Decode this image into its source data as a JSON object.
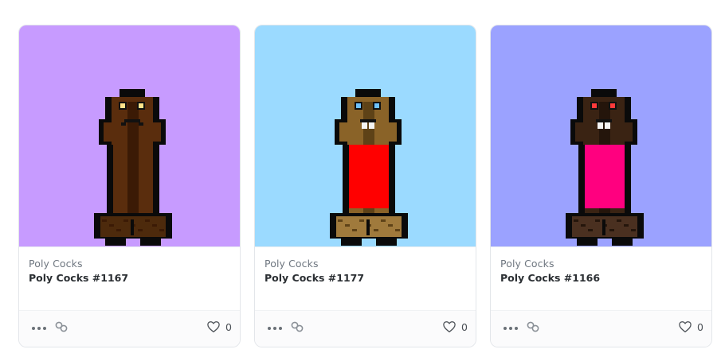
{
  "cards": [
    {
      "collection": "Poly Cocks",
      "name": "Poly Cocks #1167",
      "likes": "0",
      "background": "#c79bff",
      "skin": "#5a2d0d",
      "skin_shade": "#3b1a05",
      "eye": "#ffe38a",
      "body": "none",
      "teeth": false,
      "frown": true,
      "hair": "#4d2a0c"
    },
    {
      "collection": "Poly Cocks",
      "name": "Poly Cocks #1177",
      "likes": "0",
      "background": "#9bdaff",
      "skin": "#8a6328",
      "skin_shade": "#5e4217",
      "eye": "#6ec2ff",
      "body": "#ff0000",
      "teeth": true,
      "frown": false,
      "hair": "#a07a3c"
    },
    {
      "collection": "Poly Cocks",
      "name": "Poly Cocks #1166",
      "likes": "0",
      "background": "#9ba2ff",
      "skin": "#3a2313",
      "skin_shade": "#24150b",
      "eye": "#ff3a3a",
      "body": "#ff007f",
      "teeth": true,
      "frown": false,
      "hair": "#4a3020"
    }
  ]
}
